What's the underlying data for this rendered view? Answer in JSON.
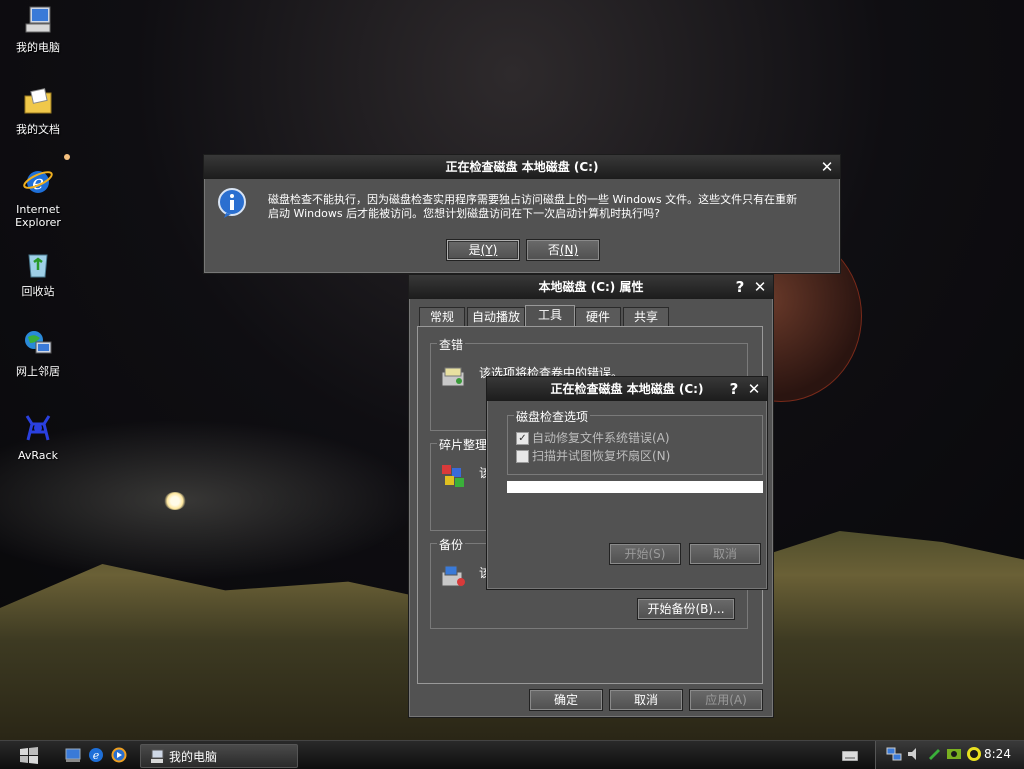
{
  "desktop": {
    "icons": [
      {
        "label": "我的电脑"
      },
      {
        "label": "我的文档"
      },
      {
        "label": "Internet Explorer"
      },
      {
        "label": "回收站"
      },
      {
        "label": "网上邻居"
      },
      {
        "label": "AvRack"
      }
    ]
  },
  "msgbox": {
    "title": "正在检查磁盘 本地磁盘 (C:)",
    "message_line1": "磁盘检查不能执行，因为磁盘检查实用程序需要独占访问磁盘上的一些 Windows 文件。这些文件只有在重新",
    "message_line2": "启动 Windows 后才能被访问。您想计划磁盘访问在下一次启动计算机时执行吗?",
    "yes": "是",
    "yes_key": "(Y)",
    "no": "否",
    "no_key": "(N)"
  },
  "props": {
    "title": "本地磁盘 (C:) 属性",
    "tabs": [
      "常规",
      "自动播放",
      "工具",
      "硬件",
      "共享"
    ],
    "active_tab": "工具",
    "group_check": "查错",
    "check_desc": "该选项将检查卷中的错误。",
    "group_defrag": "碎片整理",
    "defrag_desc": "该",
    "group_backup": "备份",
    "backup_desc": "该",
    "backup_button": "开始备份(B)...",
    "ok": "确定",
    "cancel": "取消",
    "apply": "应用(A)"
  },
  "checkdlg": {
    "title": "正在检查磁盘 本地磁盘 (C:)",
    "group": "磁盘检查选项",
    "opt1": "自动修复文件系统错误(A)",
    "opt1_checked": true,
    "opt2": "扫描并试图恢复坏扇区(N)",
    "opt2_checked": false,
    "progress": 0,
    "start": "开始(S)",
    "cancel": "取消"
  },
  "taskbar": {
    "task_label": "我的电脑",
    "clock": "8:24"
  },
  "colors": {
    "window_body": "#525252",
    "title_bar": "#1c1c1c",
    "info_icon": "#2a6fd0"
  }
}
